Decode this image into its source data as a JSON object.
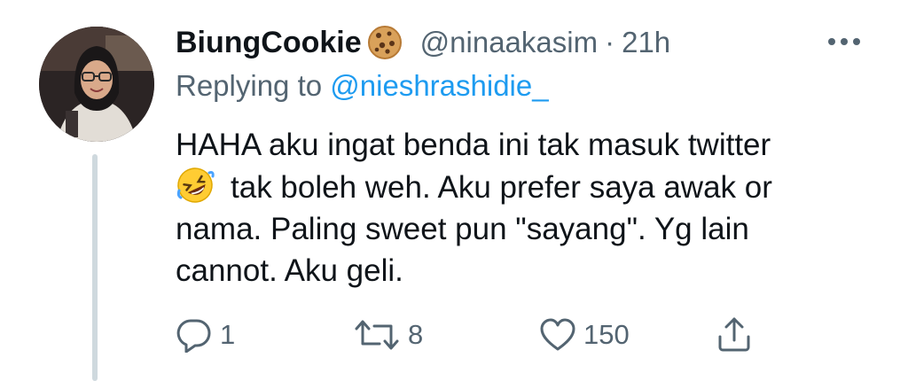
{
  "tweet": {
    "display_name": "BiungCookie",
    "name_emoji": "cookie",
    "handle": "@ninaakasim",
    "separator": "·",
    "time": "21h",
    "replying_prefix": "Replying to",
    "replying_to": "@nieshrashidie_",
    "text_line1": "HAHA aku ingat benda ini tak masuk twitter",
    "text_line2_emoji": "rolling-on-floor-laughing",
    "text_line2": "tak boleh weh. Aku prefer saya awak or",
    "text_line3": "nama. Paling sweet pun \"sayang\". Yg lain",
    "text_line4": "cannot. Aku geli."
  },
  "actions": {
    "reply_count": "1",
    "retweet_count": "8",
    "like_count": "150"
  },
  "icons": {
    "reply": "reply-icon",
    "retweet": "retweet-icon",
    "like": "heart-icon",
    "share": "share-icon",
    "more": "more-icon"
  },
  "colors": {
    "text": "#0f1419",
    "secondary": "#536471",
    "link": "#1d9bf0",
    "thread_line": "#cfd9de"
  }
}
